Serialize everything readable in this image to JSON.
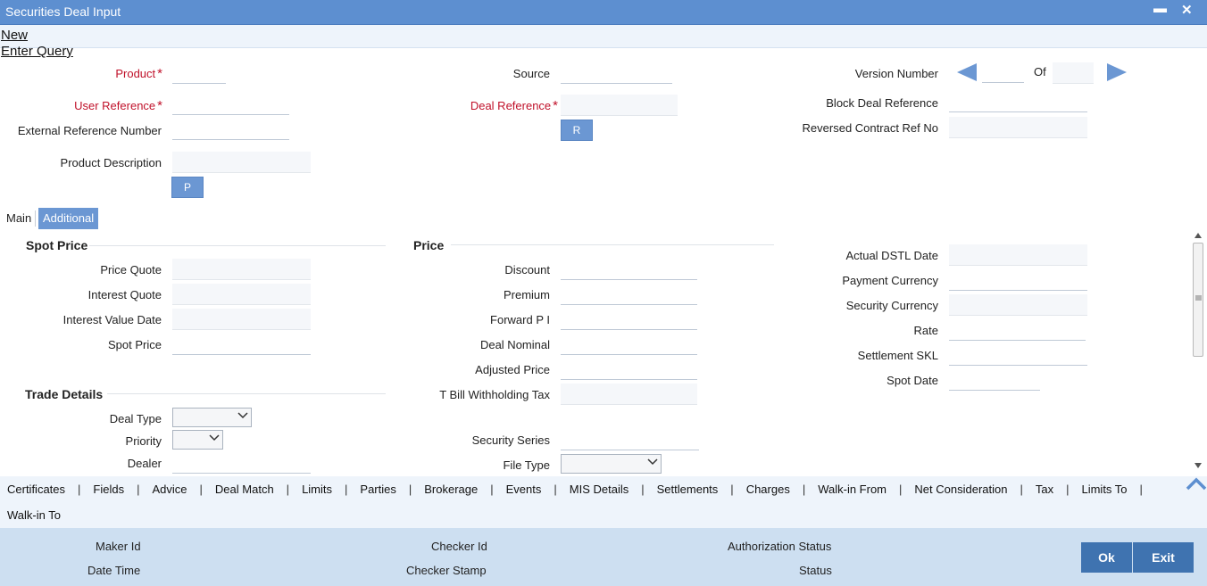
{
  "window": {
    "title": "Securities Deal Input",
    "minimize": "▬",
    "close": "✕"
  },
  "menu": {
    "new": "New",
    "enter_query": "Enter Query"
  },
  "header": {
    "product_label": "Product",
    "product_value": "",
    "user_reference_label": "User Reference",
    "user_reference_value": "",
    "external_reference_label": "External Reference Number",
    "external_reference_value": "",
    "product_description_label": "Product Description",
    "product_description_value": "",
    "p_button": "P",
    "source_label": "Source",
    "source_value": "",
    "deal_reference_label": "Deal Reference",
    "deal_reference_value": "",
    "r_button": "R",
    "version_number_label": "Version Number",
    "version_value": "",
    "of_label": "Of",
    "of_value": "",
    "block_deal_reference_label": "Block Deal Reference",
    "block_deal_reference_value": "",
    "reversed_contract_label": "Reversed Contract Ref No",
    "reversed_contract_value": ""
  },
  "tabs": {
    "main": "Main",
    "additional": "Additional"
  },
  "spot_price": {
    "heading": "Spot Price",
    "price_quote": "Price Quote",
    "interest_quote": "Interest Quote",
    "interest_value_date": "Interest Value Date",
    "spot_price": "Spot Price"
  },
  "price": {
    "heading": "Price",
    "discount": "Discount",
    "premium": "Premium",
    "forward_pi": "Forward P I",
    "deal_nominal": "Deal Nominal",
    "adjusted_price": "Adjusted Price",
    "tbill_tax": "T Bill Withholding Tax",
    "security_series": "Security Series",
    "file_type": "File Type"
  },
  "right_col": {
    "actual_dstl_date": "Actual DSTL Date",
    "payment_currency": "Payment Currency",
    "security_currency": "Security Currency",
    "rate": "Rate",
    "settlement_skl": "Settlement SKL",
    "spot_date": "Spot Date"
  },
  "trade_details": {
    "heading": "Trade Details",
    "deal_type": "Deal Type",
    "priority": "Priority",
    "dealer": "Dealer"
  },
  "footer_links": [
    "Certificates",
    "Fields",
    "Advice",
    "Deal Match",
    "Limits",
    "Parties",
    "Brokerage",
    "Events",
    "MIS Details",
    "Settlements",
    "Charges",
    "Walk-in From",
    "Net Consideration",
    "Tax",
    "Limits To",
    "Walk-in To"
  ],
  "status": {
    "maker_id": "Maker Id",
    "date_time": "Date Time",
    "checker_id": "Checker Id",
    "checker_stamp": "Checker Stamp",
    "authorization_status": "Authorization Status",
    "status": "Status",
    "ok": "Ok",
    "exit": "Exit"
  },
  "colors": {
    "titlebar": "#5d8fd0",
    "button": "#6b97d3",
    "required": "#c0112a",
    "statusbar": "#cddff1",
    "ok_button": "#3f73b0"
  }
}
